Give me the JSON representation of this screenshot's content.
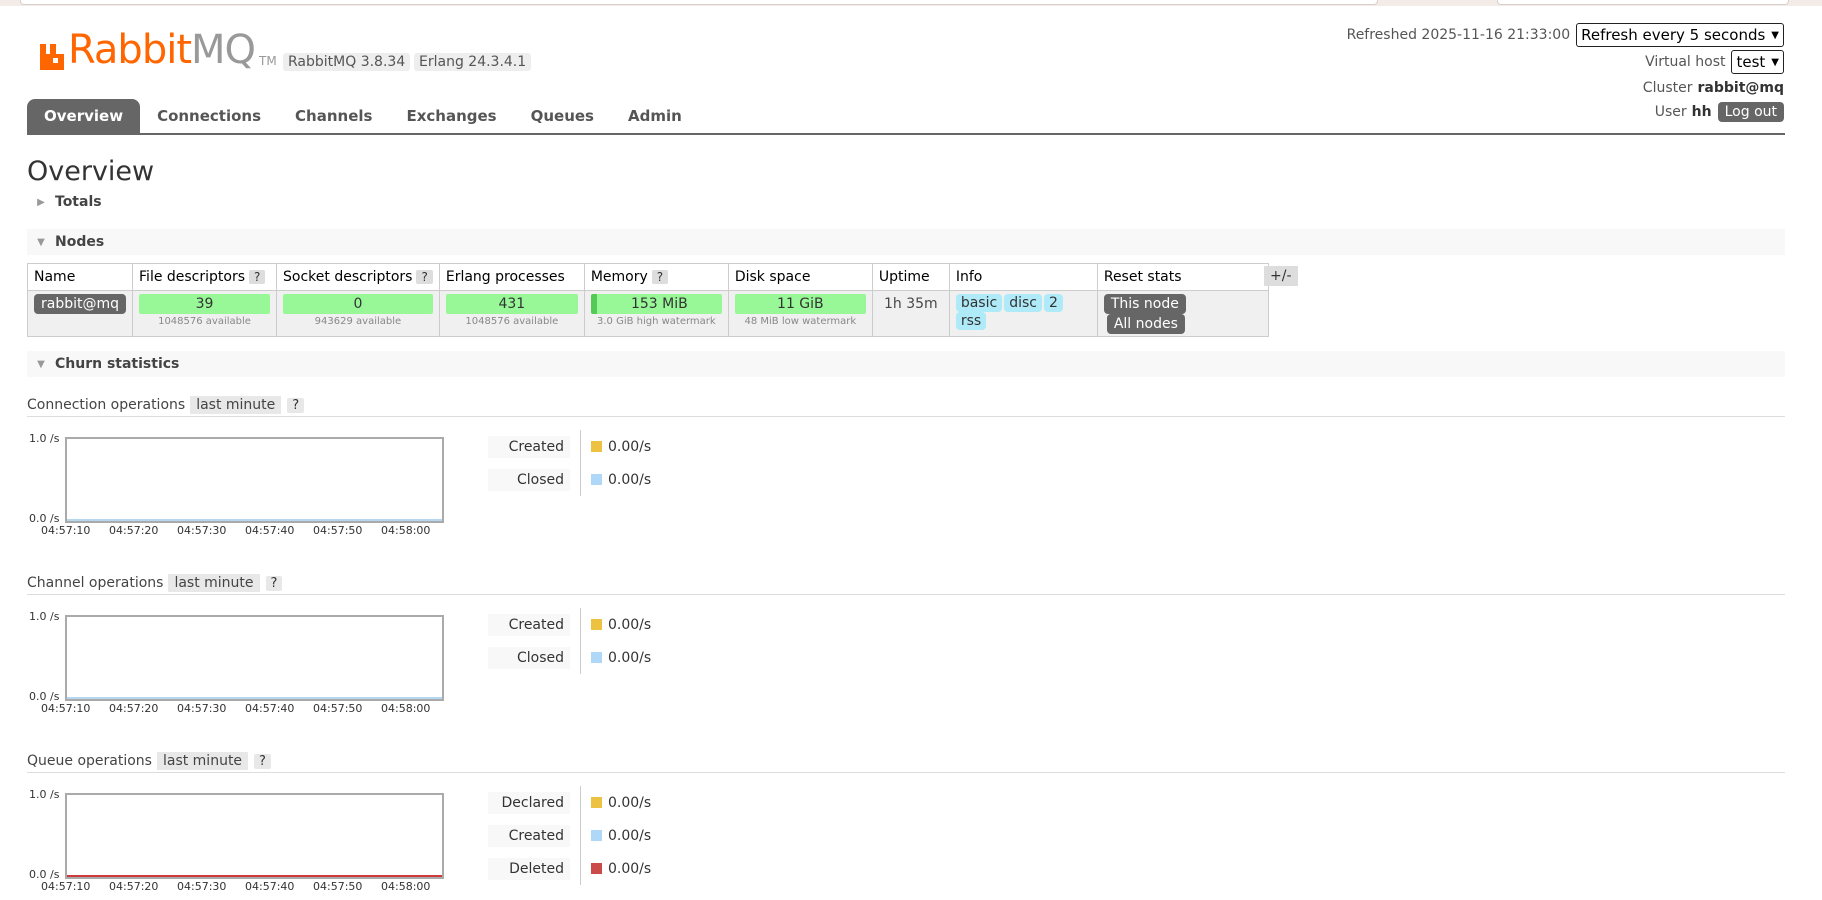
{
  "app": {
    "logo_text_rabbit": "Rabbit",
    "logo_text_mq": "MQ",
    "logo_tm": "TM",
    "version": "RabbitMQ 3.8.34",
    "erlang": "Erlang 24.3.4.1"
  },
  "header": {
    "refreshed": "Refreshed 2025-11-16 21:33:00",
    "refresh_select": "Refresh every 5 seconds",
    "vhost_label": "Virtual host",
    "vhost_value": "test",
    "cluster_label": "Cluster",
    "cluster_value": "rabbit@mq",
    "user_label": "User",
    "user_value": "hh",
    "logout": "Log out"
  },
  "tabs": [
    "Overview",
    "Connections",
    "Channels",
    "Exchanges",
    "Queues",
    "Admin"
  ],
  "page_title": "Overview",
  "sections": {
    "totals": "Totals",
    "nodes": "Nodes",
    "churn": "Churn statistics"
  },
  "nodes_table": {
    "headers": {
      "name": "Name",
      "fd": "File descriptors",
      "sd": "Socket descriptors",
      "ep": "Erlang processes",
      "mem": "Memory",
      "disk": "Disk space",
      "uptime": "Uptime",
      "info": "Info",
      "reset": "Reset stats",
      "help": "?"
    },
    "row": {
      "name": "rabbit@mq",
      "fd": "39",
      "fd_sub": "1048576 available",
      "sd": "0",
      "sd_sub": "943629 available",
      "ep": "431",
      "ep_sub": "1048576 available",
      "mem": "153 MiB",
      "mem_sub": "3.0 GiB high watermark",
      "disk": "11 GiB",
      "disk_sub": "48 MiB low watermark",
      "uptime": "1h 35m",
      "info_tags": [
        "basic",
        "disc",
        "2",
        "rss"
      ],
      "reset_this": "This node",
      "reset_all": "All nodes"
    },
    "plusminus": "+/-"
  },
  "charts": {
    "y_max": "1.0 /s",
    "y_min": "0.0 /s",
    "x_ticks": [
      "04:57:10",
      "04:57:20",
      "04:57:30",
      "04:57:40",
      "04:57:50",
      "04:58:00"
    ],
    "range_label": "last minute",
    "help": "?",
    "connection": {
      "title": "Connection operations",
      "legend": [
        {
          "name": "Created",
          "value": "0.00/s",
          "color": "#edc240"
        },
        {
          "name": "Closed",
          "value": "0.00/s",
          "color": "#afd8f8"
        }
      ]
    },
    "channel": {
      "title": "Channel operations",
      "legend": [
        {
          "name": "Created",
          "value": "0.00/s",
          "color": "#edc240"
        },
        {
          "name": "Closed",
          "value": "0.00/s",
          "color": "#afd8f8"
        }
      ]
    },
    "queue": {
      "title": "Queue operations",
      "legend": [
        {
          "name": "Declared",
          "value": "0.00/s",
          "color": "#edc240"
        },
        {
          "name": "Created",
          "value": "0.00/s",
          "color": "#afd8f8"
        },
        {
          "name": "Deleted",
          "value": "0.00/s",
          "color": "#cb4b4b"
        }
      ]
    }
  }
}
